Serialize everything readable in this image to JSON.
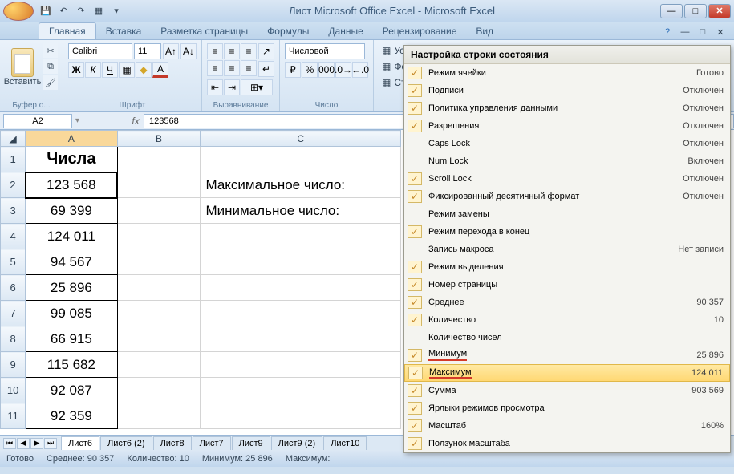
{
  "window": {
    "title": "Лист Microsoft Office Excel - Microsoft Excel"
  },
  "tabs": {
    "items": [
      "Главная",
      "Вставка",
      "Разметка страницы",
      "Формулы",
      "Данные",
      "Рецензирование",
      "Вид"
    ],
    "active": 0
  },
  "ribbon": {
    "clipboard": {
      "paste": "Вставить",
      "label": "Буфер о..."
    },
    "font": {
      "name": "Calibri",
      "size": "11",
      "label": "Шрифт"
    },
    "alignment": {
      "label": "Выравнивание"
    },
    "number": {
      "format": "Числовой",
      "label": "Число"
    },
    "styles": {
      "conditional": "Условн",
      "format": "Форма",
      "styles": "Стили"
    }
  },
  "namebox": "A2",
  "formula": "123568",
  "columns": [
    "A",
    "B",
    "C"
  ],
  "rows": [
    1,
    2,
    3,
    4,
    5,
    6,
    7,
    8,
    9,
    10,
    11
  ],
  "cells": {
    "header": "Числа",
    "a": [
      "123 568",
      "69 399",
      "124 011",
      "94 567",
      "25 896",
      "99 085",
      "66 915",
      "115 682",
      "92 087",
      "92 359"
    ],
    "c2": "Максимальное число:",
    "c3": "Минимальное число:"
  },
  "sheets": [
    "Лист6",
    "Лист6 (2)",
    "Лист8",
    "Лист7",
    "Лист9",
    "Лист9 (2)",
    "Лист10"
  ],
  "status": {
    "ready": "Готово",
    "avg_label": "Среднее:",
    "avg": "90 357",
    "count_label": "Количество:",
    "count": "10",
    "min_label": "Минимум:",
    "min": "25 896",
    "max_label": "Максимум:"
  },
  "context_menu": {
    "title": "Настройка строки состояния",
    "items": [
      {
        "checked": true,
        "label": "Режим ячейки",
        "value": "Готово"
      },
      {
        "checked": true,
        "label": "Подписи",
        "value": "Отключен"
      },
      {
        "checked": true,
        "label": "Политика управления данными",
        "value": "Отключен"
      },
      {
        "checked": true,
        "label": "Разрешения",
        "value": "Отключен"
      },
      {
        "checked": false,
        "label": "Caps Lock",
        "value": "Отключен"
      },
      {
        "checked": false,
        "label": "Num Lock",
        "value": "Включен"
      },
      {
        "checked": true,
        "label": "Scroll Lock",
        "value": "Отключен"
      },
      {
        "checked": true,
        "label": "Фиксированный десятичный формат",
        "value": "Отключен"
      },
      {
        "checked": false,
        "label": "Режим замены",
        "value": ""
      },
      {
        "checked": true,
        "label": "Режим перехода  в конец",
        "value": ""
      },
      {
        "checked": false,
        "label": "Запись макроса",
        "value": "Нет записи"
      },
      {
        "checked": true,
        "label": "Режим выделения",
        "value": ""
      },
      {
        "checked": true,
        "label": "Номер страницы",
        "value": ""
      },
      {
        "checked": true,
        "label": "Среднее",
        "value": "90 357"
      },
      {
        "checked": true,
        "label": "Количество",
        "value": "10"
      },
      {
        "checked": false,
        "label": "Количество чисел",
        "value": ""
      },
      {
        "checked": true,
        "label": "Минимум",
        "value": "25 896",
        "red": true
      },
      {
        "checked": true,
        "label": "Максимум",
        "value": "124 011",
        "highlighted": true,
        "red": true
      },
      {
        "checked": true,
        "label": "Сумма",
        "value": "903 569"
      },
      {
        "checked": true,
        "label": "Ярлыки режимов просмотра",
        "value": ""
      },
      {
        "checked": true,
        "label": "Масштаб",
        "value": "160%"
      },
      {
        "checked": true,
        "label": "Ползунок масштаба",
        "value": ""
      }
    ]
  }
}
